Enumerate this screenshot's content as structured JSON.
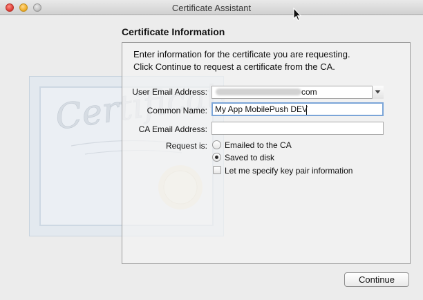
{
  "window": {
    "title": "Certificate Assistant",
    "controls": [
      "close",
      "minimize",
      "zoom"
    ]
  },
  "section_title": "Certificate Information",
  "intro": {
    "line1": "Enter information for the certificate you are requesting.",
    "line2": "Click Continue to request a certificate from the CA."
  },
  "form": {
    "user_email_label": "User Email Address:",
    "user_email_visible_suffix": "com",
    "common_name_label": "Common Name:",
    "common_name_value": "My App MobilePush DEV",
    "ca_email_label": "CA Email Address:",
    "ca_email_value": "",
    "request_is_label": "Request is:",
    "options": {
      "emailed": "Emailed to the CA",
      "saved": "Saved to disk",
      "selected": "saved"
    },
    "specify_key_pair_label": "Let me specify key pair information",
    "specify_key_pair_checked": false
  },
  "buttons": {
    "continue": "Continue"
  },
  "background_art": {
    "watermark_text": "Certificate"
  }
}
